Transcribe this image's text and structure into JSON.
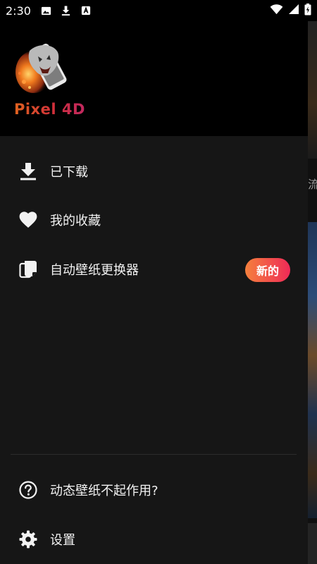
{
  "status_bar": {
    "time": "2:30",
    "icons": [
      "image-icon",
      "download-icon",
      "a-box-icon"
    ],
    "right_icons": [
      "wifi-icon",
      "signal-icon",
      "battery-icon"
    ]
  },
  "header": {
    "app_name": "Pixel 4D"
  },
  "menu": {
    "downloaded": "已下载",
    "favorites": "我的收藏",
    "auto_changer": "自动壁纸更换器",
    "new_badge": "新的",
    "live_wallpaper_help": "动态壁纸不起作用?",
    "settings": "设置"
  },
  "behind": {
    "partial_text": "流"
  },
  "colors": {
    "drawer_bg": "#161616",
    "header_bg": "#000000",
    "badge_start": "#f5803d",
    "badge_end": "#ef2a57"
  }
}
